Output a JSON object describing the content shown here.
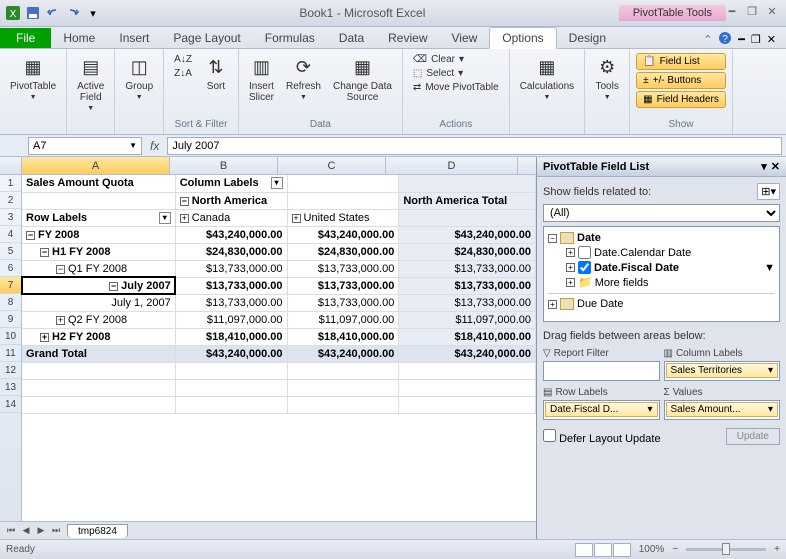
{
  "titlebar": {
    "title": "Book1 - Microsoft Excel",
    "contextual": "PivotTable Tools"
  },
  "tabs": {
    "file": "File",
    "items": [
      "Home",
      "Insert",
      "Page Layout",
      "Formulas",
      "Data",
      "Review",
      "View",
      "Options",
      "Design"
    ],
    "active": "Options"
  },
  "ribbon": {
    "pivottable": "PivotTable",
    "active_field": "Active\nField",
    "group": "Group",
    "sort_asc": "A→Z",
    "sort_desc": "Z→A",
    "sort": "Sort",
    "sort_filter_label": "Sort & Filter",
    "insert_slicer": "Insert\nSlicer",
    "refresh": "Refresh",
    "change_data": "Change Data\nSource",
    "data_label": "Data",
    "clear": "Clear",
    "select": "Select",
    "move": "Move PivotTable",
    "actions_label": "Actions",
    "calculations": "Calculations",
    "tools": "Tools",
    "field_list": "Field List",
    "buttons": "+/- Buttons",
    "field_headers": "Field Headers",
    "show_label": "Show"
  },
  "formula": {
    "name": "A7",
    "fx": "fx",
    "value": "July 2007"
  },
  "cols": [
    "A",
    "B",
    "C",
    "D"
  ],
  "cells": {
    "a1": "Sales Amount Quota",
    "b1": "Column Labels",
    "b2": "North America",
    "d2": "North America Total",
    "a3": "Row Labels",
    "b3": "Canada",
    "c3": "United States",
    "a4": "FY 2008",
    "b4": "$43,240,000.00",
    "c4": "$43,240,000.00",
    "d4": "$43,240,000.00",
    "a5": "H1 FY 2008",
    "b5": "$24,830,000.00",
    "c5": "$24,830,000.00",
    "d5": "$24,830,000.00",
    "a6": "Q1 FY 2008",
    "b6": "$13,733,000.00",
    "c6": "$13,733,000.00",
    "d6": "$13,733,000.00",
    "a7": "July 2007",
    "b7": "$13,733,000.00",
    "c7": "$13,733,000.00",
    "d7": "$13,733,000.00",
    "a8": "July 1, 2007",
    "b8": "$13,733,000.00",
    "c8": "$13,733,000.00",
    "d8": "$13,733,000.00",
    "a9": "Q2 FY 2008",
    "b9": "$11,097,000.00",
    "c9": "$11,097,000.00",
    "d9": "$11,097,000.00",
    "a10": "H2 FY 2008",
    "b10": "$18,410,000.00",
    "c10": "$18,410,000.00",
    "d10": "$18,410,000.00",
    "a11": "Grand Total",
    "b11": "$43,240,000.00",
    "c11": "$43,240,000.00",
    "d11": "$43,240,000.00"
  },
  "panel": {
    "title": "PivotTable Field List",
    "related_label": "Show fields related to:",
    "related_value": "(All)",
    "tree": {
      "date": "Date",
      "cal": "Date.Calendar Date",
      "fiscal": "Date.Fiscal Date",
      "more": "More fields",
      "due": "Due Date"
    },
    "areas_label": "Drag fields between areas below:",
    "report_filter": "Report Filter",
    "column_labels": "Column Labels",
    "row_labels": "Row Labels",
    "values": "Values",
    "col_chip": "Sales Territories",
    "row_chip": "Date.Fiscal D...",
    "val_chip": "Sales Amount...",
    "defer": "Defer Layout Update",
    "update": "Update"
  },
  "sheet": {
    "tab": "tmp6824"
  },
  "status": {
    "ready": "Ready",
    "zoom": "100%"
  }
}
